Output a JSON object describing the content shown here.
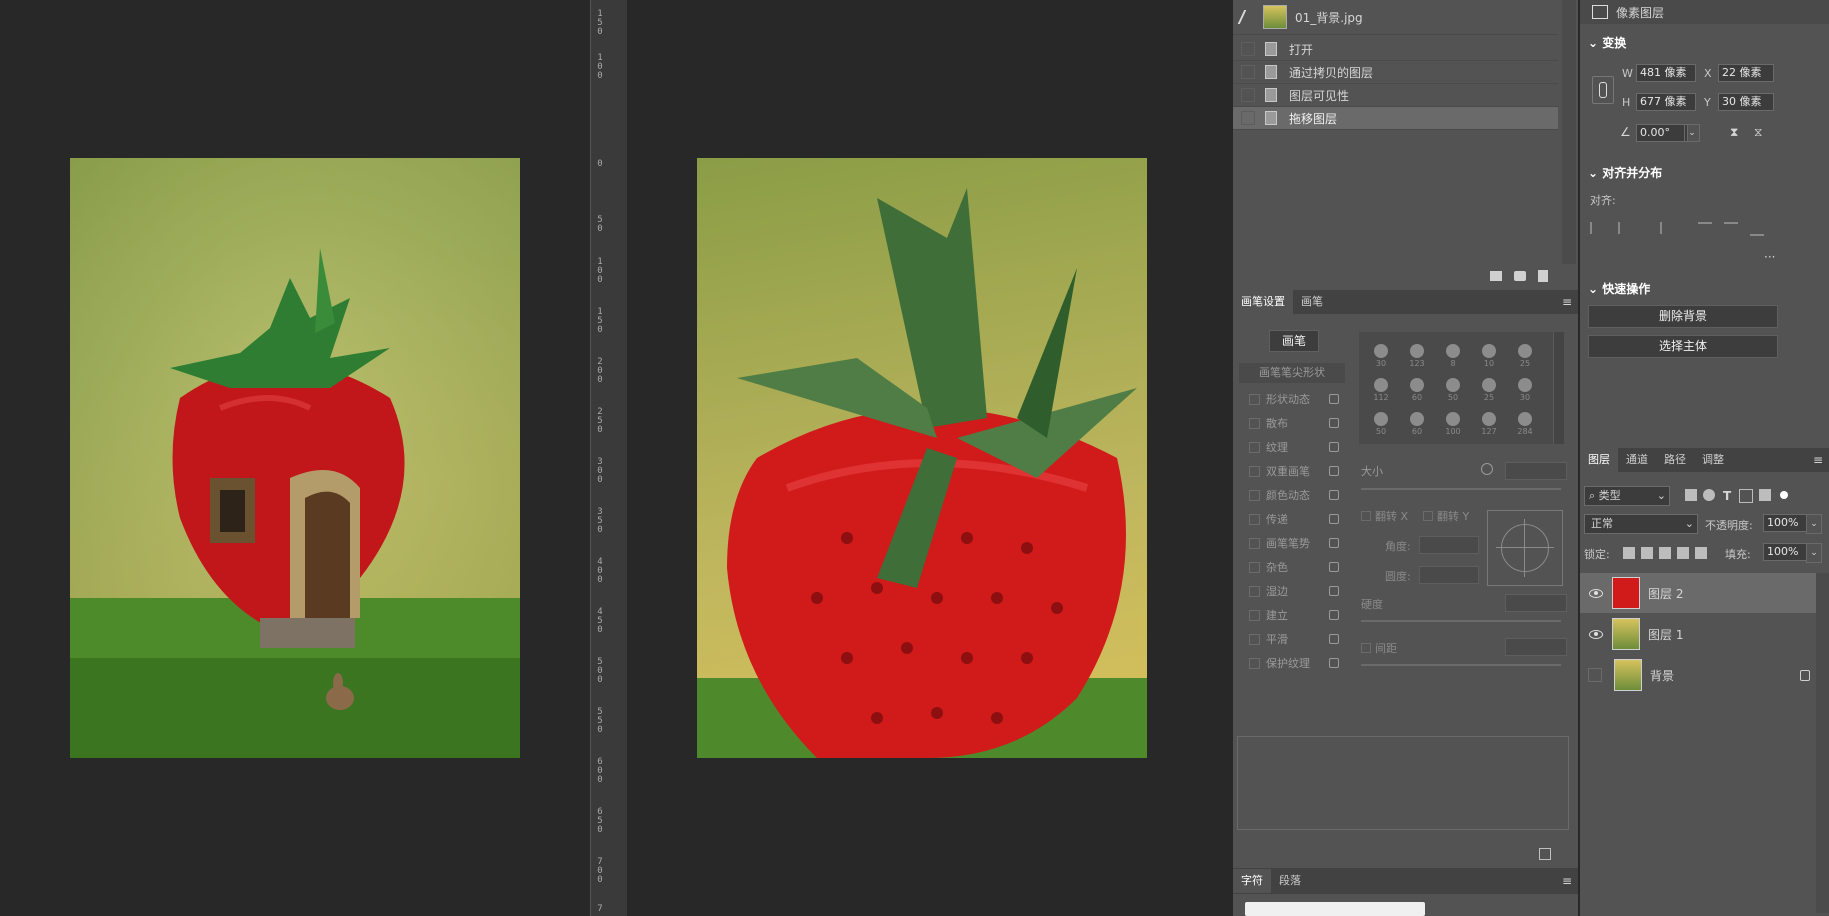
{
  "colors": {
    "workspace": "#282828",
    "panel": "#535353",
    "panel_selected": "#6a6a6a",
    "strawberry_red": "#d11a1a",
    "leaf_green": "#3f6e38",
    "bg_yellow": "#d9c25a"
  },
  "ruler": {
    "labels": [
      "1\n5\n0",
      "1\n0\n0",
      "0",
      "5\n0",
      "1\n0\n0",
      "1\n5\n0",
      "2\n0\n0",
      "2\n5\n0",
      "3\n0\n0",
      "3\n5\n0",
      "4\n0\n0",
      "4\n5\n0",
      "5\n0\n0",
      "5\n5\n0",
      "6\n0\n0",
      "6\n5\n0",
      "7\n0\n0",
      "7"
    ]
  },
  "history": {
    "source": "01_背景.jpg",
    "items": [
      "打开",
      "通过拷贝的图层",
      "图层可见性",
      "拖移图层"
    ],
    "selected_index": 3
  },
  "brush_panel": {
    "tabs": [
      "画笔设置",
      "画笔"
    ],
    "brush_button": "画笔",
    "tip_shape": "画笔笔尖形状",
    "options": [
      "形状动态",
      "散布",
      "纹理",
      "双重画笔",
      "颜色动态",
      "传递",
      "画笔笔势",
      "杂色",
      "湿边",
      "建立",
      "平滑",
      "保护纹理"
    ],
    "preset_sizes": [
      "30",
      "123",
      "8",
      "10",
      "25",
      "112",
      "60",
      "50",
      "25",
      "30",
      "50",
      "60",
      "100",
      "127",
      "284"
    ],
    "size_label": "大小",
    "flip_x": "翻转 X",
    "flip_y": "翻转 Y",
    "angle": "角度:",
    "roundness": "圆度:",
    "hardness": "硬度",
    "spacing": "间距"
  },
  "bottom_tabs": [
    "字符",
    "段落"
  ],
  "properties": {
    "layer_type": "像素图层",
    "transform_title": "变换",
    "w_label": "W",
    "w": "481 像素",
    "x_label": "X",
    "x": "22 像素",
    "h_label": "H",
    "h": "677 像素",
    "y_label": "Y",
    "y": "30 像素",
    "angle": "0.00°",
    "align_title": "对齐并分布",
    "align_label": "对齐:",
    "more": "···",
    "quick_title": "快速操作",
    "remove_bg": "删除背景",
    "select_subject": "选择主体"
  },
  "layers_panel": {
    "tabs": [
      "图层",
      "通道",
      "路径",
      "调整"
    ],
    "filter": "类型",
    "blend_mode": "正常",
    "opacity_label": "不透明度:",
    "opacity": "100%",
    "lock_label": "锁定:",
    "fill_label": "填充:",
    "fill": "100%",
    "layers": [
      {
        "name": "图层 2",
        "visible": true,
        "selected": true
      },
      {
        "name": "图层 1",
        "visible": true,
        "selected": false
      },
      {
        "name": "背景",
        "visible": false,
        "selected": false,
        "locked": true
      }
    ]
  }
}
